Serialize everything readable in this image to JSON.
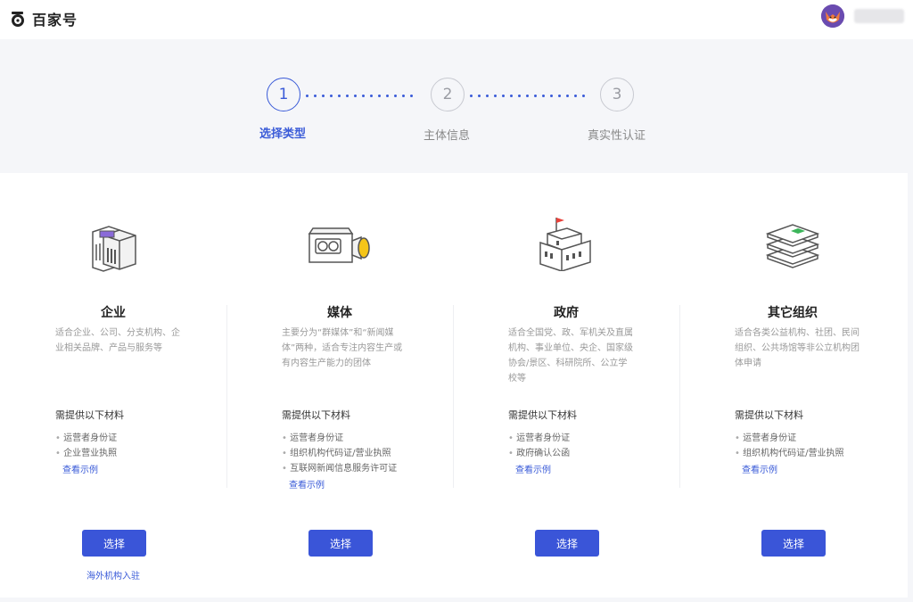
{
  "header": {
    "logo_text": "百家号"
  },
  "steps": [
    {
      "number": "1",
      "label": "选择类型",
      "active": true
    },
    {
      "number": "2",
      "label": "主体信息",
      "active": false
    },
    {
      "number": "3",
      "label": "真实性认证",
      "active": false
    }
  ],
  "colors": {
    "accent": "#3a5bd8",
    "button": "#3a55d8"
  },
  "options": [
    {
      "icon": "building-icon",
      "title": "企业",
      "description": "适合企业、公司、分支机构、企业相关品牌、产品与服务等",
      "requirements_title": "需提供以下材料",
      "requirements": [
        "运营者身份证",
        "企业营业执照"
      ],
      "example_link": "查看示例",
      "button": "选择",
      "extra_link": "海外机构入驻"
    },
    {
      "icon": "camera-icon",
      "title": "媒体",
      "description": "主要分为“群媒体”和“新闻媒体”两种，适合专注内容生产或有内容生产能力的团体",
      "requirements_title": "需提供以下材料",
      "requirements": [
        "运营者身份证",
        "组织机构代码证/营业执照",
        "互联网新闻信息服务许可证"
      ],
      "example_link": "查看示例",
      "button": "选择"
    },
    {
      "icon": "government-building-icon",
      "title": "政府",
      "description": "适合全国党、政、军机关及直属机构、事业单位、央企、国家级协会/景区、科研院所、公立学校等",
      "requirements_title": "需提供以下材料",
      "requirements": [
        "运营者身份证",
        "政府确认公函"
      ],
      "example_link": "查看示例",
      "button": "选择"
    },
    {
      "icon": "layers-icon",
      "title": "其它组织",
      "description": "适合各类公益机构、社团、民间组织、公共场馆等非公立机构团体申请",
      "requirements_title": "需提供以下材料",
      "requirements": [
        "运营者身份证",
        "组织机构代码证/营业执照"
      ],
      "example_link": "查看示例",
      "button": "选择"
    }
  ]
}
